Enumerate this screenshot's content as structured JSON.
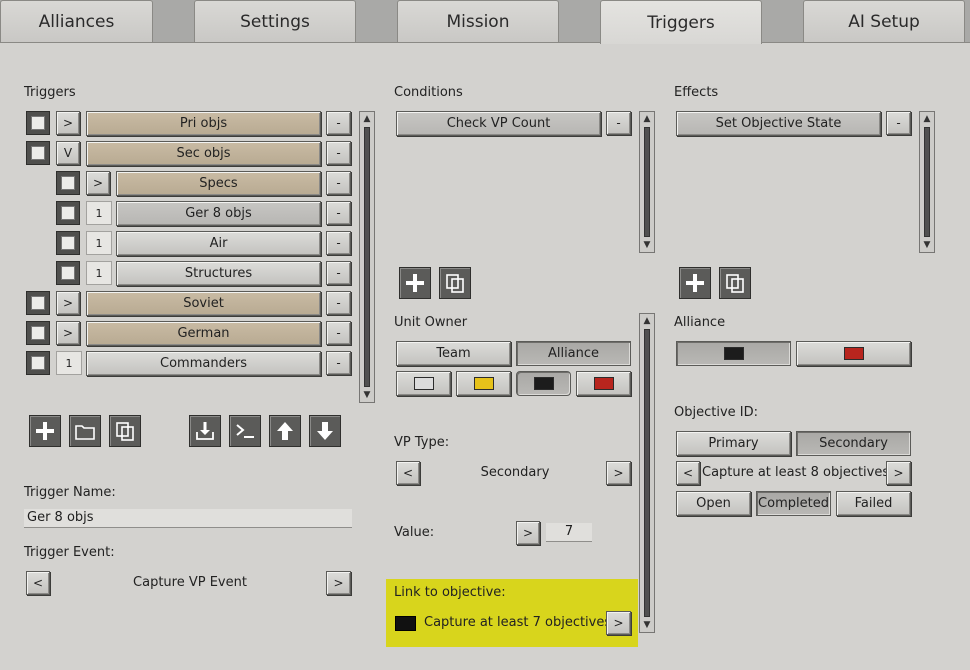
{
  "tabs": [
    "Alliances",
    "Settings",
    "Mission",
    "Triggers",
    "AI Setup"
  ],
  "triggers": {
    "section_label": "Triggers",
    "rows": [
      {
        "expander": ">",
        "label": "Pri objs",
        "remove": "-"
      },
      {
        "expander": "V",
        "label": "Sec objs",
        "remove": "-"
      },
      {
        "expander": ">",
        "label": "Specs",
        "remove": "-"
      },
      {
        "expander": "1",
        "label": "Ger 8 objs",
        "remove": "-"
      },
      {
        "expander": "1",
        "label": "Air",
        "remove": "-"
      },
      {
        "expander": "1",
        "label": "Structures",
        "remove": "-"
      },
      {
        "expander": ">",
        "label": "Soviet",
        "remove": "-"
      },
      {
        "expander": ">",
        "label": "German",
        "remove": "-"
      },
      {
        "expander": "1",
        "label": "Commanders",
        "remove": "-"
      }
    ],
    "name_label": "Trigger Name:",
    "name_value": "Ger 8 objs",
    "event_label": "Trigger Event:",
    "event_prev": "<",
    "event_value": "Capture VP Event",
    "event_next": ">"
  },
  "conditions": {
    "section_label": "Conditions",
    "item": "Check VP Count",
    "remove": "-",
    "unit_owner_label": "Unit Owner",
    "owner_tabs": [
      "Team",
      "Alliance"
    ],
    "vp_type_label": "VP Type:",
    "vp_prev": "<",
    "vp_type_value": "Secondary",
    "vp_next": ">",
    "value_label": "Value:",
    "value_arrow": ">",
    "value": "7",
    "link_label": "Link to objective:",
    "link_value": "Capture at least 7 objectives",
    "link_arrow": ">"
  },
  "effects": {
    "section_label": "Effects",
    "item": "Set Objective State",
    "remove": "-",
    "alliance_label": "Alliance",
    "objective_id_label": "Objective ID:",
    "obj_tabs": [
      "Primary",
      "Secondary"
    ],
    "obj_prev": "<",
    "obj_value": "Capture at least 8 objectives",
    "obj_next": ">",
    "states": [
      "Open",
      "Completed",
      "Failed"
    ]
  },
  "colors": {
    "highlight": "#d8d51c",
    "swatch_white": "#dcdcdc",
    "swatch_yellow": "#e6c21a",
    "swatch_black": "#1c1c1c",
    "swatch_red": "#b8251e"
  }
}
